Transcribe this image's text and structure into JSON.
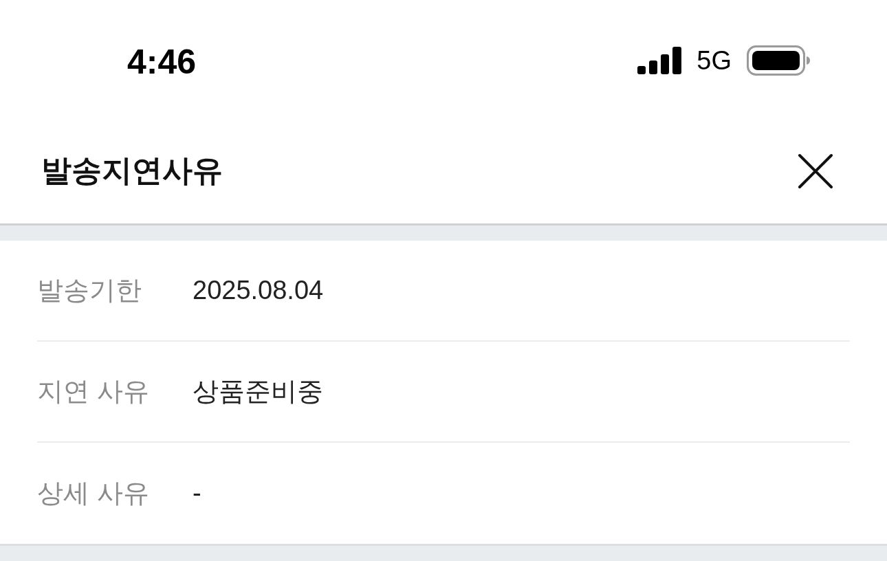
{
  "status_bar": {
    "time": "4:46",
    "network": "5G"
  },
  "header": {
    "title": "발송지연사유"
  },
  "details": [
    {
      "label": "발송기한",
      "value": "2025.08.04"
    },
    {
      "label": "지연 사유",
      "value": "상품준비중"
    },
    {
      "label": "상세 사유",
      "value": "-"
    }
  ]
}
